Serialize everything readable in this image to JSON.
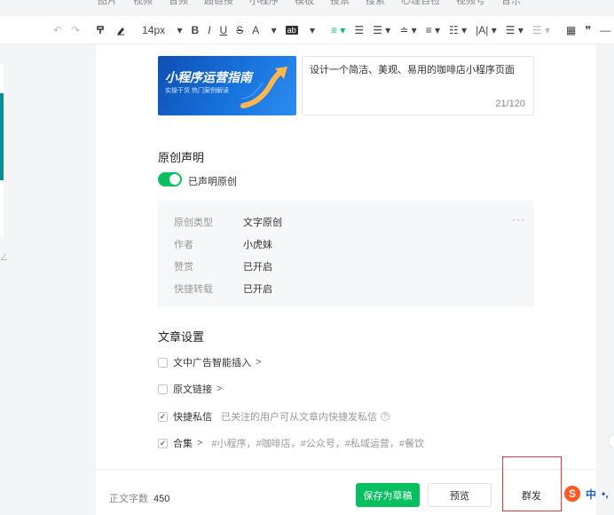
{
  "top_menu": [
    "图片",
    "视频",
    "音频",
    "超链接",
    "小程序",
    "模板",
    "投票",
    "搜索",
    "心理自检",
    "视频号",
    "音乐"
  ],
  "toolbar": {
    "undo": "↶",
    "redo": "↷",
    "font_size": "14px",
    "bold": "B",
    "italic": "I",
    "underline": "U",
    "strike": "S",
    "font_color": "A",
    "bg_color": "ab",
    "quote": "❞",
    "hr": "—",
    "code": "</"
  },
  "article": {
    "cover": {
      "title": "小程序运营指南",
      "subtitle": "实操干货 热门案例解读"
    },
    "summary": {
      "text": "设计一个简洁、美观、易用的咖啡店小程序页面",
      "count": "21/120"
    }
  },
  "original": {
    "section_title": "原创声明",
    "toggle_label": "已声明原创",
    "toggle_on": true,
    "more": "···",
    "rows": [
      {
        "key": "原创类型",
        "value": "文字原创"
      },
      {
        "key": "作者",
        "value": "小虎妹"
      },
      {
        "key": "赞赏",
        "value": "已开启"
      },
      {
        "key": "快捷转载",
        "value": "已开启"
      }
    ]
  },
  "settings": {
    "section_title": "文章设置",
    "ad_insert": {
      "label": "文中广告智能插入",
      "checked": false,
      "arrow": ">"
    },
    "source_link": {
      "label": "原文链接",
      "checked": false,
      "arrow": ">"
    },
    "quick_message": {
      "label": "快捷私信",
      "checked": true,
      "hint": "已关注的用户可从文章内快捷发私信",
      "help": "?"
    },
    "collection": {
      "label": "合集",
      "checked": true,
      "arrow": ">",
      "tags": "#小程序，#咖啡店，#公众号，#私域运营，#餐饮"
    }
  },
  "bottom": {
    "word_count_label": "正文字数",
    "word_count": "450",
    "save_draft": "保存为草稿",
    "preview": "预览",
    "send": "群发"
  },
  "ime": {
    "logo": "S",
    "mode": "中",
    "punct": "•,"
  },
  "colors": {
    "accent": "#07c160",
    "highlight": "#e53935"
  }
}
